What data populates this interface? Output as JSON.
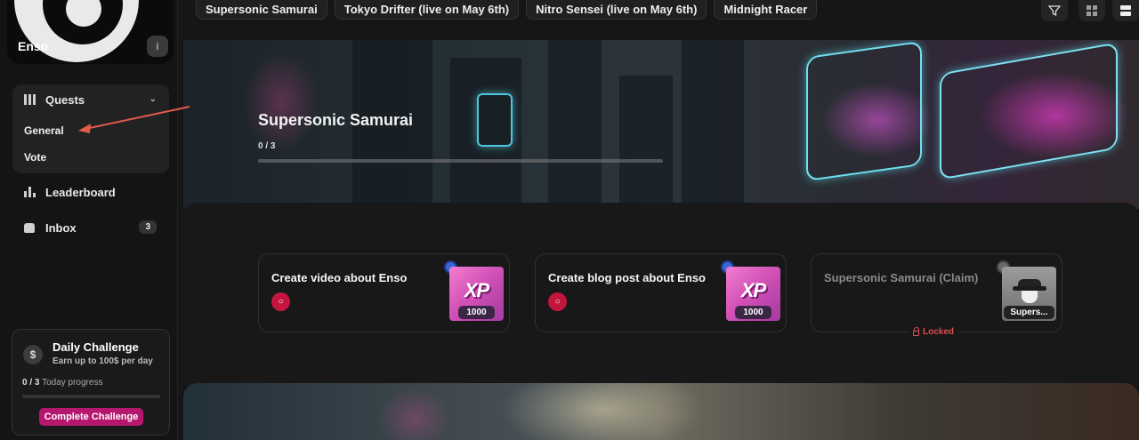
{
  "brand": {
    "name": "Enso",
    "info_icon": "info-icon"
  },
  "sidebar": {
    "quests": {
      "label": "Quests",
      "icon": "map-icon",
      "items": [
        {
          "label": "General"
        },
        {
          "label": "Vote"
        }
      ]
    },
    "leaderboard": {
      "label": "Leaderboard",
      "icon": "bar-chart-icon"
    },
    "inbox": {
      "label": "Inbox",
      "icon": "inbox-icon",
      "badge": "3"
    }
  },
  "daily_challenge": {
    "title": "Daily Challenge",
    "subtitle": "Earn up to 100$ per day",
    "progress_value": "0 / 3",
    "progress_label": "Today progress",
    "button": "Complete Challenge"
  },
  "tabs": [
    {
      "label": "Supersonic Samurai"
    },
    {
      "label": "Tokyo Drifter (live on May 6th)"
    },
    {
      "label": "Nitro Sensei (live on May 6th)"
    },
    {
      "label": "Midnight Racer"
    }
  ],
  "banner": {
    "title": "Supersonic Samurai",
    "progress": "0 / 3",
    "progress_fraction": 0
  },
  "quests": [
    {
      "title": "Create video about Enso",
      "reward_type": "xp",
      "reward_text": "XP",
      "reward_amount": "1000",
      "locked": false
    },
    {
      "title": "Create blog post about Enso",
      "reward_type": "xp",
      "reward_text": "XP",
      "reward_amount": "1000",
      "locked": false
    },
    {
      "title": "Supersonic Samurai (Claim)",
      "reward_type": "character",
      "reward_amount": "Supers...",
      "locked": true
    }
  ],
  "locked_label": "Locked",
  "colors": {
    "accent": "#b5176e",
    "link": "#c4163d",
    "locked": "#e04e4e"
  }
}
